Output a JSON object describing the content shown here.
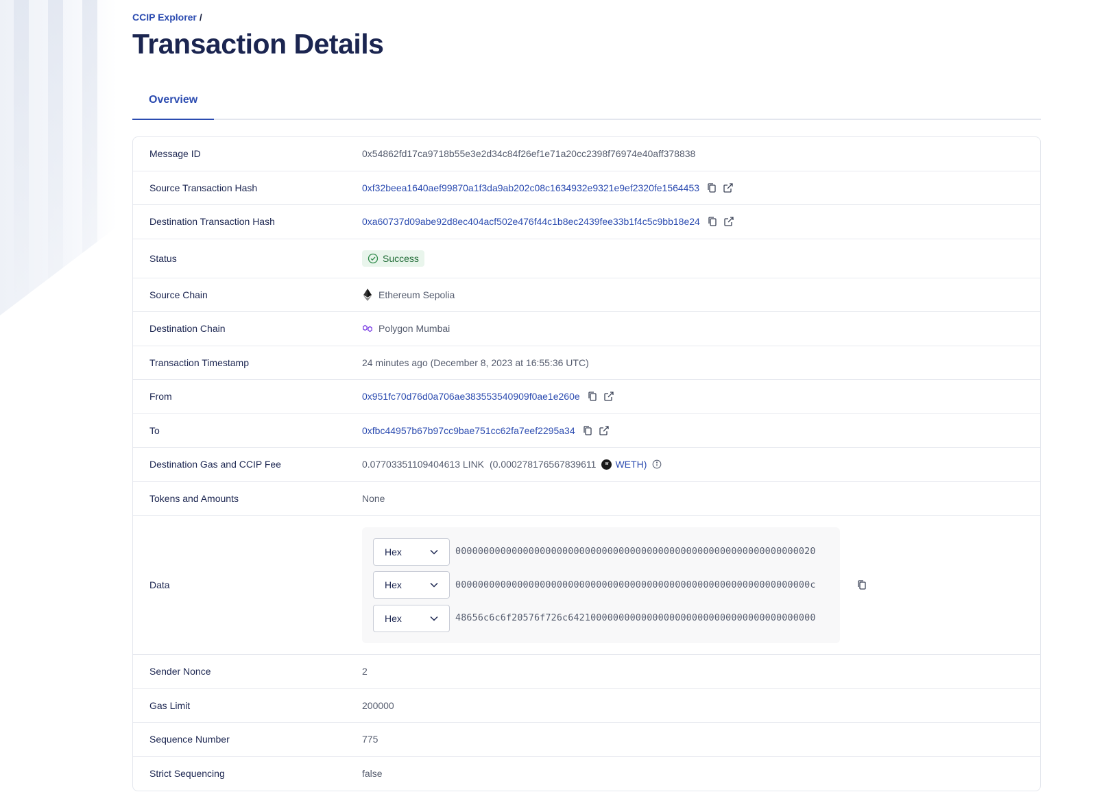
{
  "breadcrumb": {
    "root": "CCIP Explorer",
    "separator": "/"
  },
  "page_title": "Transaction Details",
  "tabs": [
    {
      "label": "Overview",
      "active": true
    }
  ],
  "details": {
    "message_id": {
      "label": "Message ID",
      "value": "0x54862fd17ca9718b55e3e2d34c84f26ef1e71a20cc2398f76974e40aff378838"
    },
    "source_tx_hash": {
      "label": "Source Transaction Hash",
      "value": "0xf32beea1640aef99870a1f3da9ab202c08c1634932e9321e9ef2320fe1564453"
    },
    "dest_tx_hash": {
      "label": "Destination Transaction Hash",
      "value": "0xa60737d09abe92d8ec404acf502e476f44c1b8ec2439fee33b1f4c5c9bb18e24"
    },
    "status": {
      "label": "Status",
      "value": "Success"
    },
    "source_chain": {
      "label": "Source Chain",
      "value": "Ethereum Sepolia",
      "icon": "ethereum-icon"
    },
    "dest_chain": {
      "label": "Destination Chain",
      "value": "Polygon Mumbai",
      "icon": "polygon-icon"
    },
    "timestamp": {
      "label": "Transaction Timestamp",
      "value": "24 minutes ago (December 8, 2023 at 16:55:36 UTC)"
    },
    "from": {
      "label": "From",
      "value": "0x951fc70d76d0a706ae383553540909f0ae1e260e"
    },
    "to": {
      "label": "To",
      "value": "0xfbc44957b67b97cc9bae751cc62fa7eef2295a34"
    },
    "fee": {
      "label": "Destination Gas and CCIP Fee",
      "link_amount": "0.07703351109404613 LINK",
      "paren_open": "(0.000278176567839611",
      "token": "WETH",
      "paren_close": ")"
    },
    "tokens": {
      "label": "Tokens and Amounts",
      "value": "None"
    },
    "data": {
      "label": "Data",
      "lines": [
        {
          "format": "Hex",
          "value": "0000000000000000000000000000000000000000000000000000000000000020"
        },
        {
          "format": "Hex",
          "value": "000000000000000000000000000000000000000000000000000000000000000c"
        },
        {
          "format": "Hex",
          "value": "48656c6c6f20576f726c64210000000000000000000000000000000000000000"
        }
      ]
    },
    "sender_nonce": {
      "label": "Sender Nonce",
      "value": "2"
    },
    "gas_limit": {
      "label": "Gas Limit",
      "value": "200000"
    },
    "sequence_number": {
      "label": "Sequence Number",
      "value": "775"
    },
    "strict_sequencing": {
      "label": "Strict Sequencing",
      "value": "false"
    }
  },
  "colors": {
    "accent": "#2b4bb0",
    "title": "#1b2550",
    "success_bg": "#e9f5ec",
    "success_fg": "#1f6b35"
  }
}
